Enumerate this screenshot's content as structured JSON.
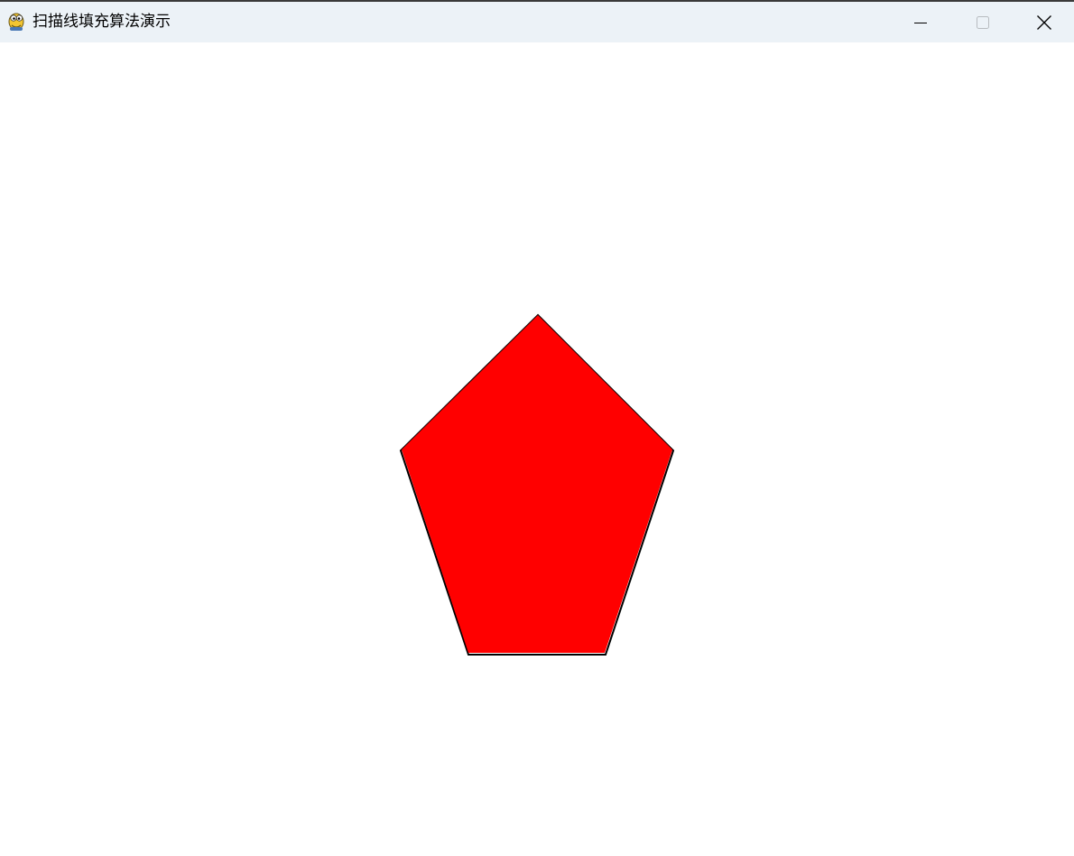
{
  "window": {
    "title": "扫描线填充算法演示",
    "icon": "python-snake-icon",
    "controls": {
      "minimize": "minimize-icon",
      "maximize": "maximize-icon",
      "close": "close-icon"
    }
  },
  "canvas": {
    "background": "#ffffff",
    "shape": {
      "type": "pentagon",
      "fill": "#ff0000",
      "outline": "#000000"
    }
  }
}
